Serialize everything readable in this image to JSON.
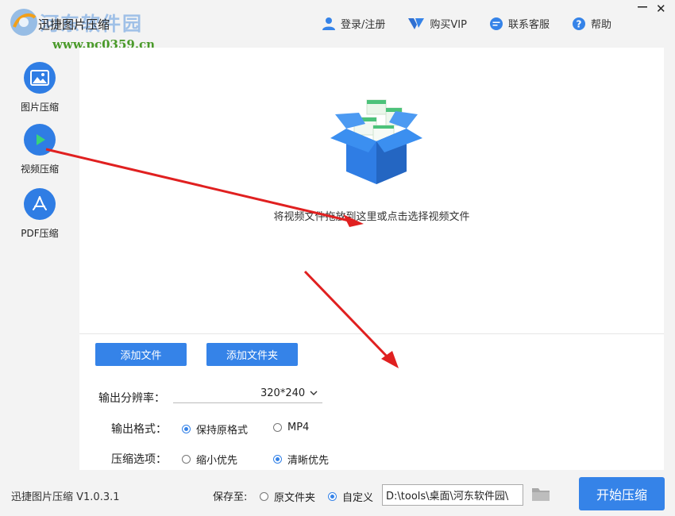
{
  "app": {
    "title": "迅捷图片压缩",
    "watermark_name": "河东软件园",
    "watermark_url": "www.pc0359.cn",
    "version": "迅捷图片压缩 V1.0.3.1"
  },
  "header": {
    "actions": [
      {
        "label": "登录/注册",
        "icon": "user-icon"
      },
      {
        "label": "购买VIP",
        "icon": "vip-icon"
      },
      {
        "label": "联系客服",
        "icon": "chat-icon"
      },
      {
        "label": "帮助",
        "icon": "help-icon"
      }
    ],
    "window": {
      "minimize": "minimize-icon",
      "close": "✕"
    }
  },
  "sidebar": {
    "items": [
      {
        "label": "图片压缩",
        "icon": "image-icon",
        "active": false
      },
      {
        "label": "视频压缩",
        "icon": "play-icon",
        "active": true
      },
      {
        "label": "PDF压缩",
        "icon": "pdf-icon",
        "active": false
      }
    ]
  },
  "dropzone": {
    "hint": "将视频文件拖放到这里或点击选择视频文件",
    "illustration": "open-box-icon"
  },
  "toolbar": {
    "add_file": "添加文件",
    "add_folder": "添加文件夹"
  },
  "settings": {
    "resolution_label": "输出分辨率：",
    "resolution_value": "320*240",
    "format_label": "输出格式：",
    "format_options": [
      {
        "label": "保持原格式",
        "checked": true
      },
      {
        "label": "MP4",
        "checked": false
      }
    ],
    "compress_label": "压缩选项：",
    "compress_options": [
      {
        "label": "缩小优先",
        "checked": false
      },
      {
        "label": "清晰优先",
        "checked": true
      }
    ]
  },
  "bottom": {
    "save_label": "保存至:",
    "save_options": [
      {
        "label": "原文件夹",
        "checked": false
      },
      {
        "label": "自定义",
        "checked": true
      }
    ],
    "path_value": "D:\\tools\\桌面\\河东软件园\\",
    "start_label": "开始压缩"
  },
  "colors": {
    "accent": "#3583e8",
    "annotation_arrow": "#e02020",
    "background": "#f3f3f3"
  }
}
